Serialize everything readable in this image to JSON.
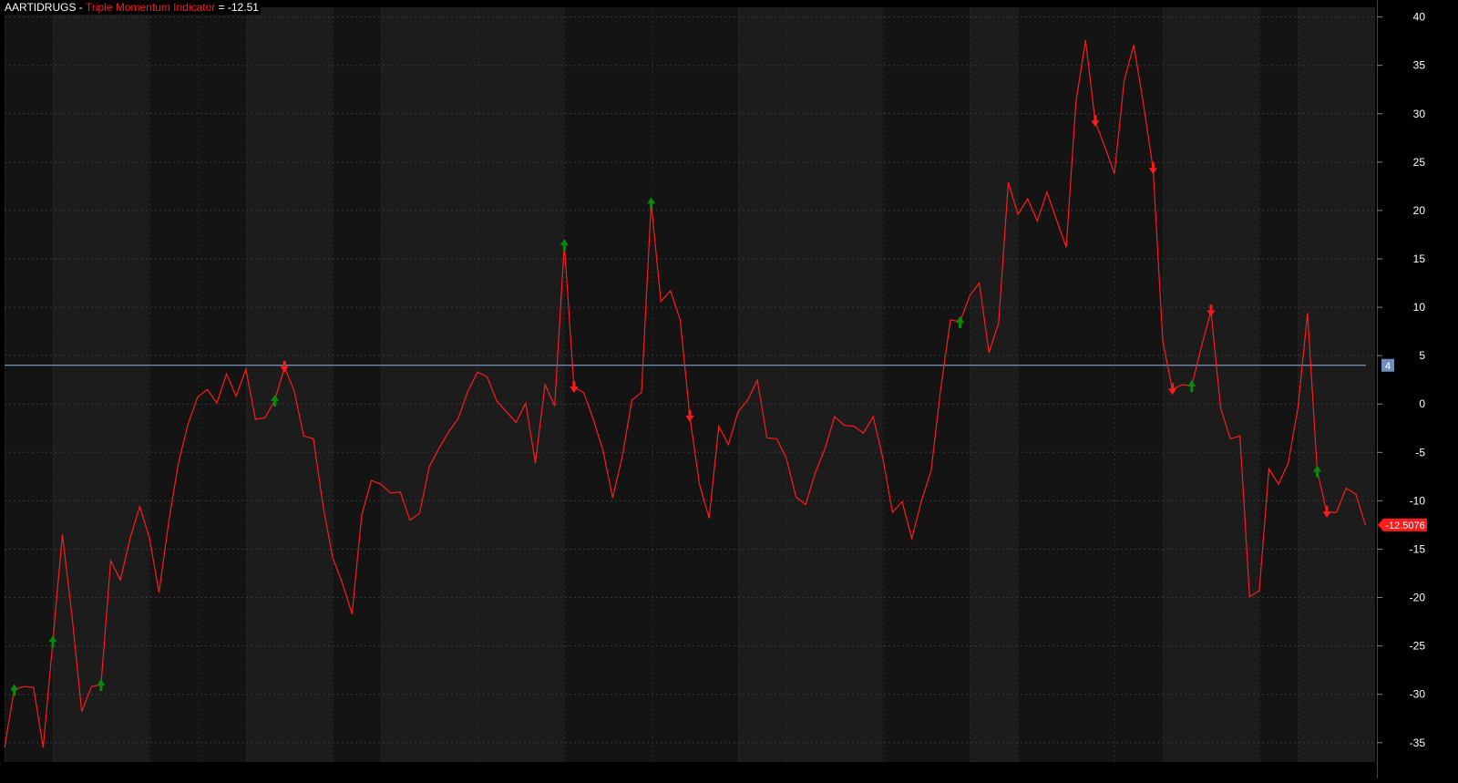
{
  "header": {
    "symbol": "AARTIDRUGS",
    "sep1": " - ",
    "indicator": "Triple Momentum Indicator",
    "sep2": " = ",
    "value": "-12.51"
  },
  "colors": {
    "background": "#000000",
    "panel_dark": "#141414",
    "panel_light": "#1c1c1c",
    "grid": "#3a3a3a",
    "line": "#ff1a1a",
    "threshold": "#8fb0e8",
    "buy_arrow": "#0a8a0a",
    "sell_arrow": "#ff1a1a",
    "axis_text": "#ffffff"
  },
  "chart_data": {
    "type": "line",
    "title": "Triple Momentum Indicator",
    "ylim": [
      -37,
      41
    ],
    "yticks": [
      40,
      35,
      30,
      25,
      20,
      15,
      10,
      5,
      0,
      -5,
      -10,
      -15,
      -20,
      -25,
      -30,
      -35
    ],
    "grid": true,
    "x_count": 143,
    "series": [
      {
        "name": "Triple Momentum Indicator",
        "values": [
          -35.5,
          -29.5,
          -29.2,
          -29.3,
          -35.5,
          -24.5,
          -13.5,
          -22,
          -31.8,
          -29.2,
          -29.0,
          -16.2,
          -18.2,
          -13.9,
          -10.6,
          -13.8,
          -19.5,
          -12.2,
          -6.2,
          -2.1,
          0.7,
          1.5,
          0.1,
          3.1,
          0.8,
          3.6,
          -1.6,
          -1.4,
          0.4,
          3.8,
          1.4,
          -3.3,
          -3.6,
          -10.5,
          -15.9,
          -18.5,
          -21.7,
          -11.5,
          -7.9,
          -8.3,
          -9.2,
          -9.1,
          -12.0,
          -11.3,
          -6.5,
          -4.6,
          -2.9,
          -1.5,
          1.3,
          3.3,
          2.8,
          0.3,
          -0.8,
          -1.9,
          0.1,
          -6.1,
          2.0,
          -0.2,
          16.5,
          1.7,
          1.2,
          -1.6,
          -4.8,
          -9.7,
          -5.4,
          0.4,
          1.2,
          20.8,
          10.6,
          11.7,
          8.7,
          -1.3,
          -8.3,
          -11.8,
          -2.3,
          -4.2,
          -0.8,
          0.4,
          2.5,
          -3.5,
          -3.6,
          -5.6,
          -9.6,
          -10.4,
          -7.1,
          -4.6,
          -1.3,
          -2.2,
          -2.3,
          -3.0,
          -1.3,
          -5.6,
          -11.2,
          -10.1,
          -13.9,
          -10.0,
          -6.9,
          1.6,
          8.7,
          8.5,
          11.2,
          12.5,
          5.3,
          8.4,
          22.9,
          19.6,
          21.2,
          18.9,
          21.9,
          19.0,
          16.2,
          31.2,
          37.6,
          29.2,
          26.6,
          23.8,
          33.4,
          37.1,
          31.0,
          24.3,
          6.5,
          1.5,
          2.0,
          1.9,
          5.9,
          9.6,
          -0.4,
          -3.6,
          -3.3,
          -19.9,
          -19.3,
          -6.7,
          -8.3,
          -6.1,
          -0.4,
          9.4,
          -6.9,
          -11.2,
          -11.2,
          -8.7,
          -9.3,
          -12.5
        ]
      }
    ],
    "threshold_line": {
      "value": 4,
      "label": "4"
    },
    "last_value_label": "-12.5076",
    "buy_signals": [
      1,
      5,
      10,
      28,
      58,
      67,
      99,
      123,
      136
    ],
    "sell_signals": [
      29,
      59,
      71,
      113,
      119,
      121,
      125,
      137
    ],
    "bands": [
      {
        "start": 0,
        "end": 5,
        "shade": "dark"
      },
      {
        "start": 5,
        "end": 15,
        "shade": "light"
      },
      {
        "start": 15,
        "end": 20,
        "shade": "dark"
      },
      {
        "start": 20,
        "end": 25,
        "shade": "dark"
      },
      {
        "start": 25,
        "end": 34,
        "shade": "light"
      },
      {
        "start": 34,
        "end": 39,
        "shade": "dark"
      },
      {
        "start": 39,
        "end": 49,
        "shade": "light"
      },
      {
        "start": 49,
        "end": 58,
        "shade": "light"
      },
      {
        "start": 58,
        "end": 67,
        "shade": "dark"
      },
      {
        "start": 67,
        "end": 76,
        "shade": "dark"
      },
      {
        "start": 76,
        "end": 81,
        "shade": "light"
      },
      {
        "start": 81,
        "end": 91,
        "shade": "light"
      },
      {
        "start": 91,
        "end": 100,
        "shade": "dark"
      },
      {
        "start": 100,
        "end": 105,
        "shade": "light"
      },
      {
        "start": 105,
        "end": 115,
        "shade": "dark"
      },
      {
        "start": 115,
        "end": 120,
        "shade": "dark"
      },
      {
        "start": 120,
        "end": 130,
        "shade": "light"
      },
      {
        "start": 130,
        "end": 134,
        "shade": "dark"
      },
      {
        "start": 134,
        "end": 142,
        "shade": "light"
      }
    ]
  }
}
